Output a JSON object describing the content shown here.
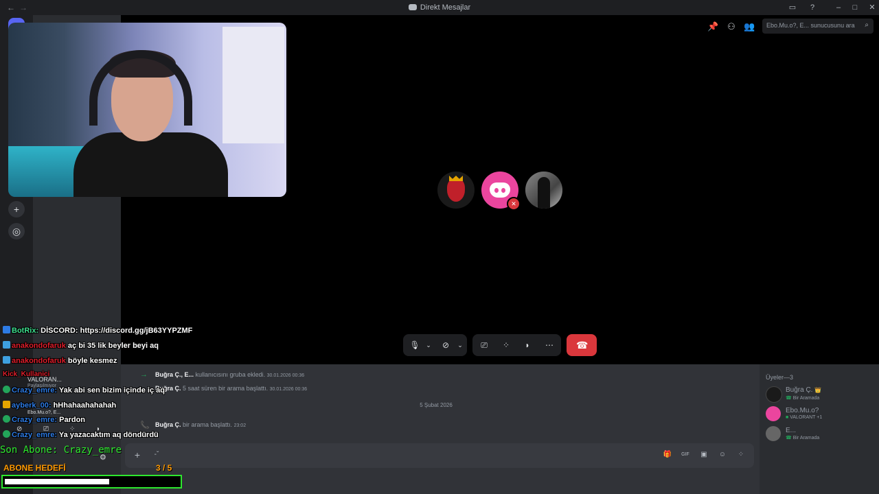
{
  "window": {
    "title": "Direkt Mesajlar",
    "nav_back": "←",
    "nav_forward": "→"
  },
  "stage": {
    "search_placeholder": "Ebo.Mu.o?, E... sunucusunu ara",
    "participants": [
      "Buğra Ç.",
      "Ebo.Mu.o?",
      "E..."
    ]
  },
  "messages": {
    "events": [
      {
        "user": "Buğra Ç., E...",
        "text": "kullanıcısını gruba ekledi.",
        "time": "30.01.2026 00:36"
      },
      {
        "user": "Buğra Ç.",
        "text": "5 saat süren bir arama başlattı.",
        "time": "30.01.2026 00:36"
      },
      {
        "user": "Buğra Ç.",
        "text": "bir arama başlattı.",
        "time": "23:02"
      }
    ],
    "date_divider": "5 Şubat 2026"
  },
  "members": {
    "header": "Üyeler—3",
    "list": [
      {
        "name": "Buğra Ç.",
        "status": "Bir Aramada",
        "crown": "👑"
      },
      {
        "name": "Ebo.Mu.o?",
        "status": "VALORANT +1"
      },
      {
        "name": "E...",
        "status": "Bir Aramada"
      }
    ]
  },
  "overlay": {
    "chat": [
      {
        "user": "BotRix:",
        "text": "DİSCORD: https://discord.gg/jB63YYPZMF",
        "color": "#3ee08f"
      },
      {
        "user": "anakondofaruk",
        "text": "aç bi 35 lik beyler beyi aq",
        "color": "#e01e2b"
      },
      {
        "user": "anakondofaruk",
        "text": "böyle kesmez",
        "color": "#e01e2b"
      },
      {
        "user": "Crazy_emre:",
        "text": "Yak abi sen bizim içinde iç aq",
        "color": "#2d7be5"
      },
      {
        "user": "ayberk_00:",
        "text": "hHhahaahahahah",
        "color": "#2d7be5"
      },
      {
        "user": "Crazy_emre:",
        "text": "Pardon",
        "color": "#2d7be5"
      },
      {
        "user": "Crazy_emre:",
        "text": "Ya yazacaktım aq döndürdü",
        "color": "#2d7be5"
      }
    ],
    "kick_label": "Kick_Kullanici",
    "activity_title": "VALORAN...",
    "activity_sub": "Paylaşılmıyor",
    "mini_user": "Ebo.Mu.o?, E...",
    "last_sub": "Son Abone: Crazy_emre",
    "goal_label": "ABONE HEDEFİ",
    "goal_count": "3  / 5",
    "goal_current": 3,
    "goal_target": 5
  },
  "colors": {
    "accent": "#5865f2",
    "danger": "#da373c",
    "online": "#23a55a",
    "goal": "#2ee82e"
  }
}
